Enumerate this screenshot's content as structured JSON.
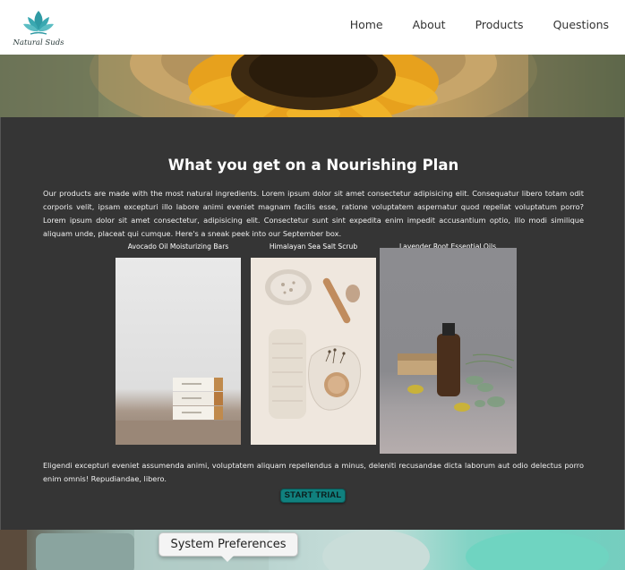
{
  "logo": {
    "text": "Natural Suds",
    "icon": "lotus-icon"
  },
  "nav": {
    "items": [
      {
        "label": "Home"
      },
      {
        "label": "About"
      },
      {
        "label": "Products"
      },
      {
        "label": "Questions"
      }
    ]
  },
  "plan": {
    "title": "What you get on a Nourishing Plan",
    "intro": "Our products are made with the most natural ingredients. Lorem ipsum dolor sit amet consectetur adipisicing elit. Consequatur libero totam odit corporis velit, ipsam excepturi illo labore animi eveniet magnam facilis esse, ratione voluptatem aspernatur quod repellat voluptatum porro? Lorem ipsum dolor sit amet consectetur, adipisicing elit. Consectetur sunt sint expedita enim impedit accusantium optio, illo modi similique aliquam unde, placeat qui cumque. Here's a sneak peek into our September box.",
    "products": [
      {
        "name": "Avocado Oil Moisturizing Bars"
      },
      {
        "name": "Himalayan Sea Salt Scrub"
      },
      {
        "name": "Lavender Root Essential Oils"
      }
    ],
    "outro": "Eligendi excepturi eveniet assumenda animi, voluptatem aliquam repellendus a minus, deleniti recusandae dicta laborum aut odio delectus porro enim omnis! Repudiandae, libero.",
    "cta_label": "START TRIAL"
  },
  "tooltip": {
    "text": "System Preferences"
  },
  "colors": {
    "accent": "#10807e",
    "panel_bg": "#353535",
    "logo_teal": "#2f9aa4"
  }
}
